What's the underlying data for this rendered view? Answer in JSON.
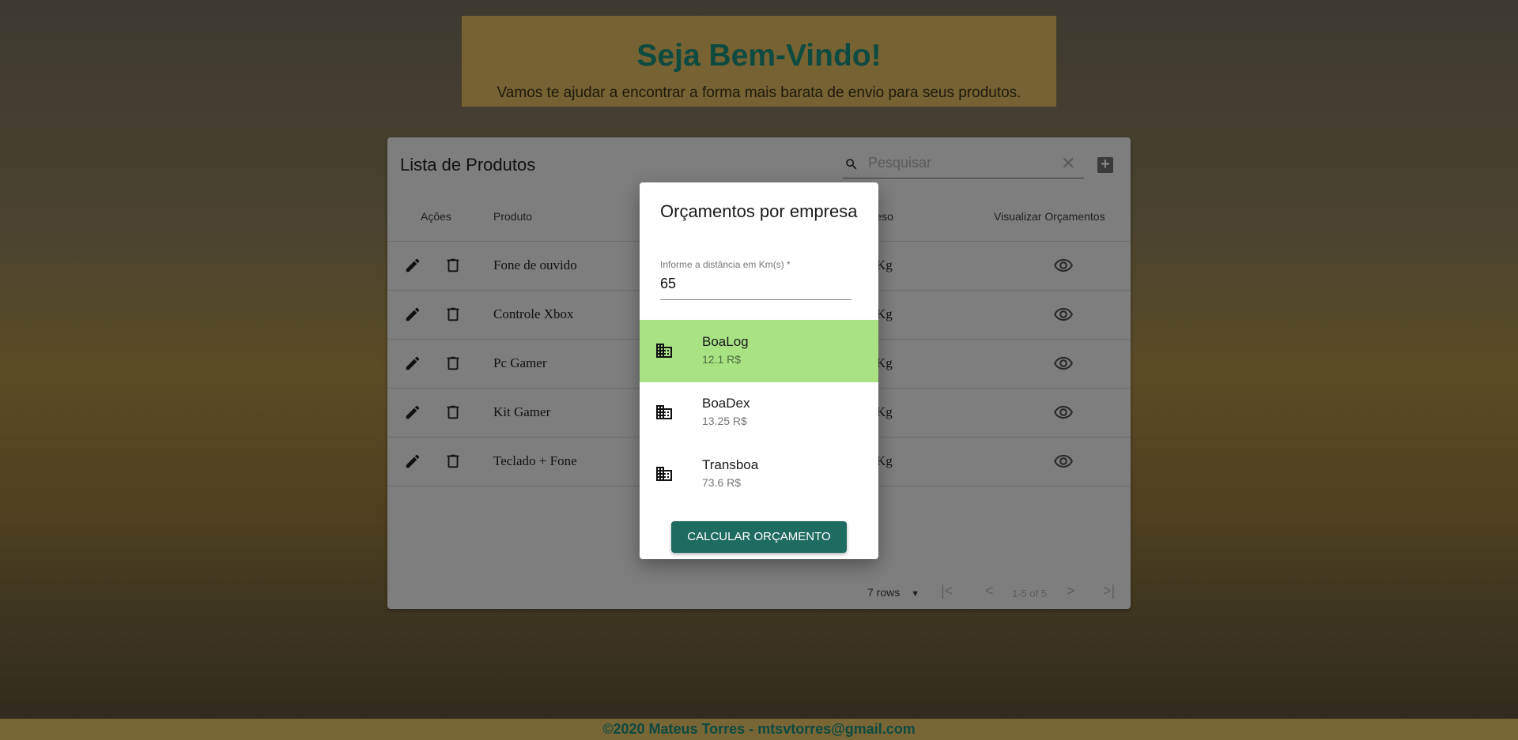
{
  "hero": {
    "title": "Seja Bem-Vindo!",
    "subtitle": "Vamos te ajudar a encontrar a forma mais barata de envio para seus produtos."
  },
  "table": {
    "title": "Lista de Produtos",
    "search_placeholder": "Pesquisar",
    "headers": {
      "actions": "Ações",
      "product": "Produto",
      "weight": "Peso",
      "view": "Visualizar Orçamentos"
    },
    "rows": [
      {
        "product": "Fone de ouvido",
        "weight": "Kg"
      },
      {
        "product": "Controle Xbox",
        "weight": "Kg"
      },
      {
        "product": "Pc Gamer",
        "weight": "Kg"
      },
      {
        "product": "Kit Gamer",
        "weight": "Kg"
      },
      {
        "product": "Teclado + Fone",
        "weight": "Kg"
      }
    ],
    "pagination": {
      "rows_per_page": "7 rows",
      "range": "1-5 of 5"
    }
  },
  "modal": {
    "title": "Orçamentos por empresa",
    "distance_label": "Informe a distância em Km(s) *",
    "distance_value": "65",
    "companies": [
      {
        "name": "BoaLog",
        "price": "12.1 R$",
        "selected": true
      },
      {
        "name": "BoaDex",
        "price": "13.25 R$",
        "selected": false
      },
      {
        "name": "Transboa",
        "price": "73.6 R$",
        "selected": false
      }
    ],
    "button": "CALCULAR ORÇAMENTO",
    "highlight_color": "#a8e283",
    "button_color": "#1e6b60"
  },
  "footer": {
    "text": "©2020 Mateus Torres - mtsvtorres@gmail.com"
  }
}
